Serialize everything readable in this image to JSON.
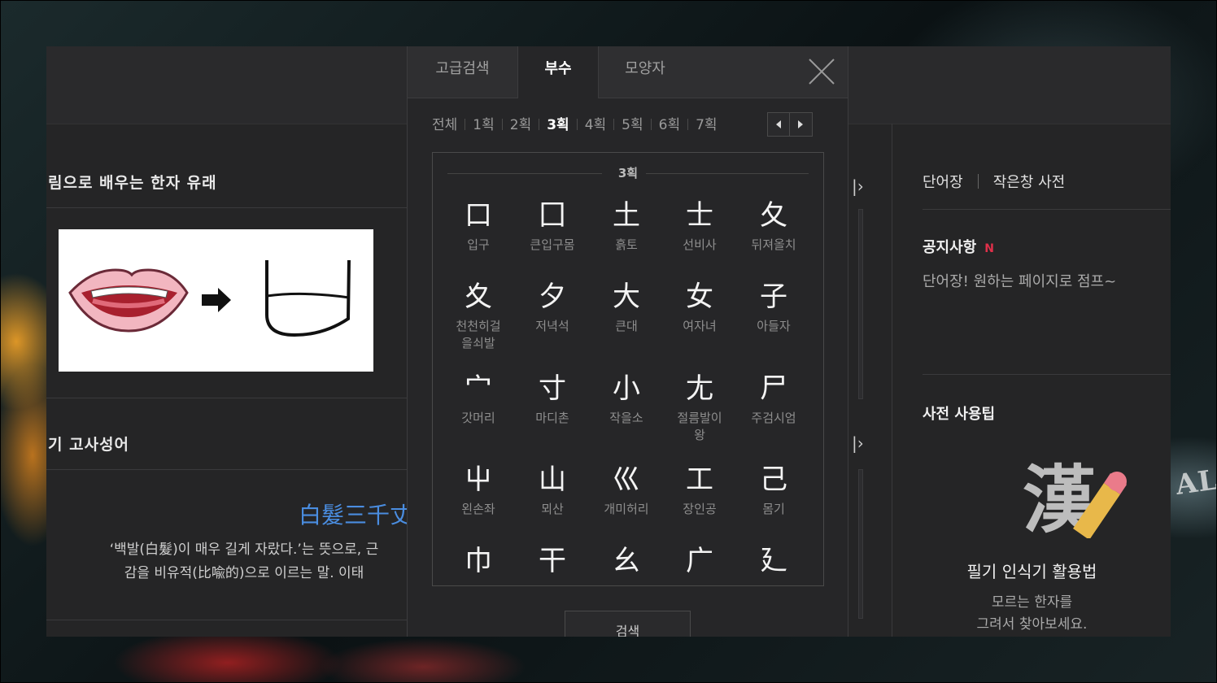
{
  "background": {
    "sign_text": "ALLE"
  },
  "left": {
    "section1_title": "림으로 배우는 한자 유래",
    "section2_title": "기 고사성어",
    "idiom_hanja": "白髮三千丈",
    "idiom_desc_line1": "‘백발(白髮)이 매우 길게 자랐다.’는 뜻으로, 근",
    "idiom_desc_line2": "감을 비유적(比喩的)으로 이르는 말. 이태"
  },
  "popup": {
    "tabs": [
      {
        "label": "고급검색",
        "active": false
      },
      {
        "label": "부수",
        "active": true
      },
      {
        "label": "모양자",
        "active": false
      }
    ],
    "stroke_filters": [
      "전체",
      "1획",
      "2획",
      "3획",
      "4획",
      "5획",
      "6획",
      "7획"
    ],
    "active_stroke": "3획",
    "grid_label": "3획",
    "radicals": [
      {
        "char": "口",
        "name": "입구"
      },
      {
        "char": "囗",
        "name": "큰입구몸"
      },
      {
        "char": "土",
        "name": "흙토"
      },
      {
        "char": "士",
        "name": "선비사"
      },
      {
        "char": "夂",
        "name": "뒤져올치"
      },
      {
        "char": "夊",
        "name": "천천히걸\n을쇠발"
      },
      {
        "char": "夕",
        "name": "저녁석"
      },
      {
        "char": "大",
        "name": "큰대"
      },
      {
        "char": "女",
        "name": "여자녀"
      },
      {
        "char": "子",
        "name": "아들자"
      },
      {
        "char": "宀",
        "name": "갓머리"
      },
      {
        "char": "寸",
        "name": "마디촌"
      },
      {
        "char": "小",
        "name": "작을소"
      },
      {
        "char": "尢",
        "name": "절름발이\n왕"
      },
      {
        "char": "尸",
        "name": "주검시엄"
      },
      {
        "char": "屮",
        "name": "왼손좌"
      },
      {
        "char": "山",
        "name": "뫼산"
      },
      {
        "char": "巛",
        "name": "개미허리"
      },
      {
        "char": "工",
        "name": "장인공"
      },
      {
        "char": "己",
        "name": "몸기"
      },
      {
        "char": "巾",
        "name": ""
      },
      {
        "char": "干",
        "name": ""
      },
      {
        "char": "幺",
        "name": ""
      },
      {
        "char": "广",
        "name": ""
      },
      {
        "char": "廴",
        "name": ""
      }
    ],
    "search_button": "검색"
  },
  "right": {
    "link_wordbook": "단어장",
    "link_mini_dict": "작은창 사전",
    "notice_title": "공지사항",
    "notice_badge": "N",
    "notice_text": "단어장! 원하는 페이지로 점프~",
    "tip_title": "사전 사용팁",
    "tip_logo_char": "漢",
    "tip_heading": "필기 인식기 활용법",
    "tip_sub_line1": "모르는 한자를",
    "tip_sub_line2": "그려서 찾아보세요."
  },
  "colors": {
    "page_bg": "#252526",
    "popup_bg": "#262628",
    "accent_blue": "#4a8de0",
    "badge_red": "#e0304a"
  }
}
